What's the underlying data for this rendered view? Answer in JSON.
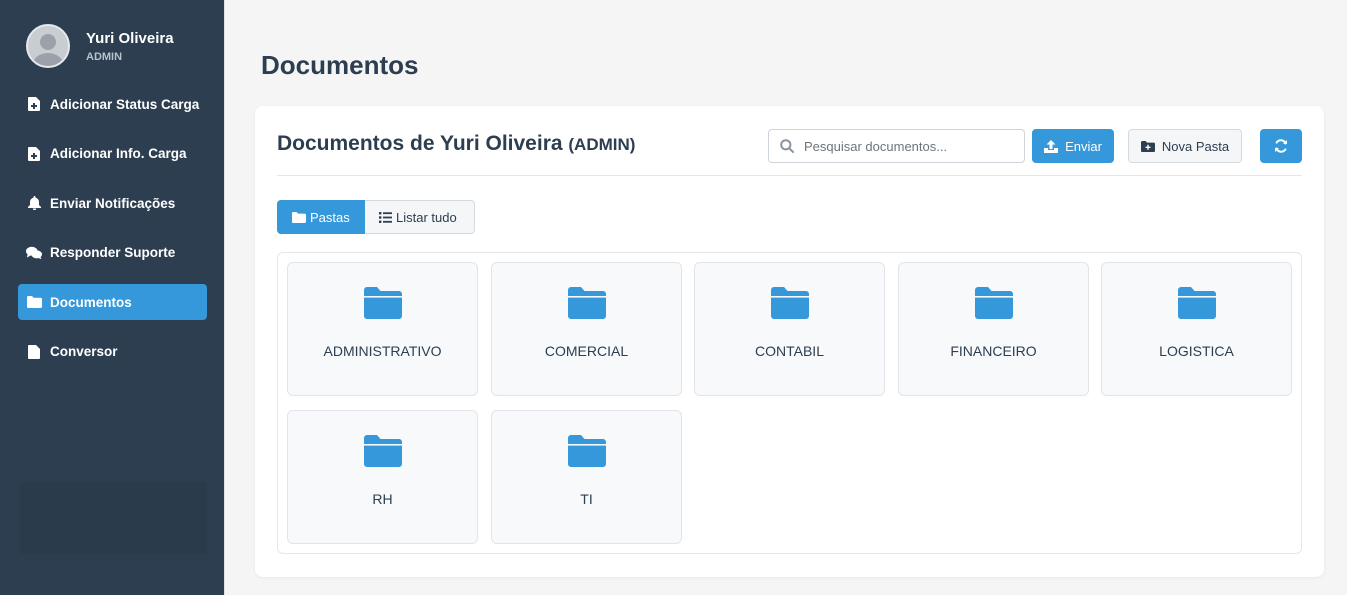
{
  "user": {
    "name": "Yuri Oliveira",
    "role": "ADMIN"
  },
  "nav": [
    {
      "label": "Adicionar Status Carga",
      "icon": "file-plus-icon",
      "active": false
    },
    {
      "label": "Adicionar Info. Carga",
      "icon": "file-plus-icon",
      "active": false
    },
    {
      "label": "Enviar Notificações",
      "icon": "bell-icon",
      "active": false
    },
    {
      "label": "Responder Suporte",
      "icon": "comments-icon",
      "active": false
    },
    {
      "label": "Documentos",
      "icon": "folder-icon",
      "active": true
    },
    {
      "label": "Conversor",
      "icon": "file-icon",
      "active": false
    }
  ],
  "page": {
    "title": "Documentos"
  },
  "card": {
    "title": "Documentos de Yuri Oliveira",
    "title_role": "(ADMIN)",
    "search_placeholder": "Pesquisar documentos...",
    "send_label": "Enviar",
    "new_folder_label": "Nova Pasta"
  },
  "view_toggle": {
    "folders_label": "Pastas",
    "list_label": "Listar tudo",
    "active": "folders"
  },
  "folders": [
    "ADMINISTRATIVO",
    "COMERCIAL",
    "CONTABIL",
    "FINANCEIRO",
    "LOGISTICA",
    "RH",
    "TI"
  ],
  "colors": {
    "sidebar": "#2c3e50",
    "accent": "#3498db",
    "text": "#2c3e50"
  }
}
